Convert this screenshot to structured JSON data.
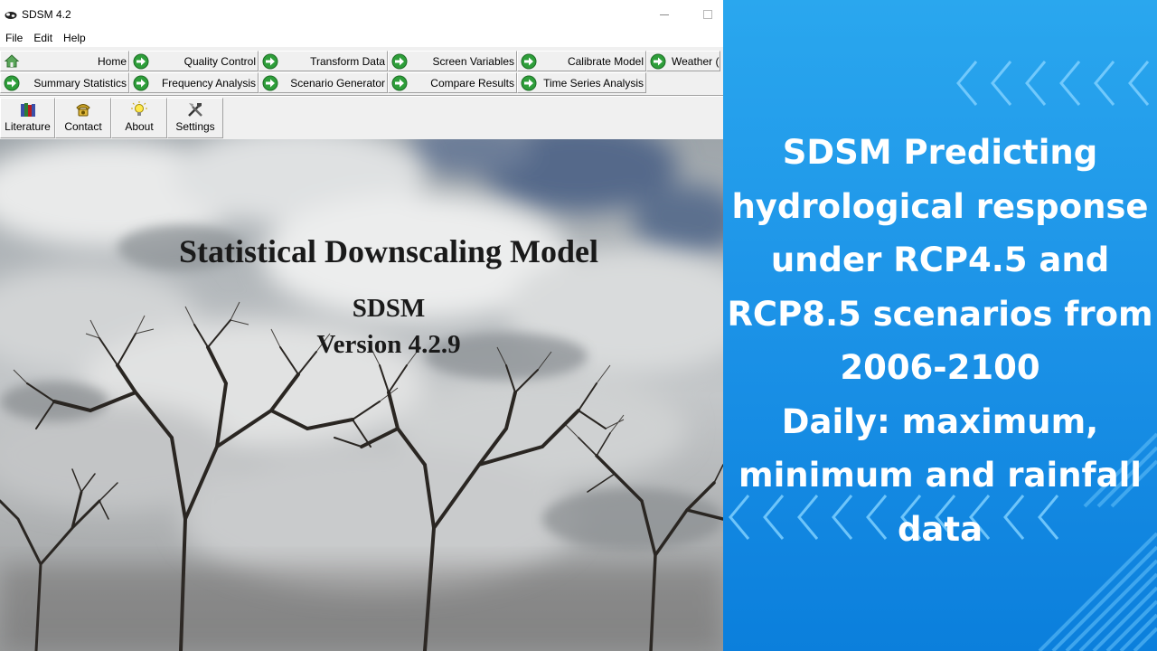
{
  "window": {
    "title": "SDSM 4.2"
  },
  "menu": [
    "File",
    "Edit",
    "Help"
  ],
  "nav_row_1": [
    {
      "label": "Home",
      "icon": "home-icon"
    },
    {
      "label": "Quality Control",
      "icon": "arrow-right-icon"
    },
    {
      "label": "Transform Data",
      "icon": "arrow-right-icon"
    },
    {
      "label": "Screen Variables",
      "icon": "arrow-right-icon"
    },
    {
      "label": "Calibrate Model",
      "icon": "arrow-right-icon"
    },
    {
      "label": "Weather (",
      "icon": "arrow-right-icon"
    }
  ],
  "nav_row_2": [
    {
      "label": "Summary Statistics",
      "icon": "arrow-right-icon"
    },
    {
      "label": "Frequency Analysis",
      "icon": "arrow-right-icon"
    },
    {
      "label": "Scenario Generator",
      "icon": "arrow-right-icon"
    },
    {
      "label": "Compare Results",
      "icon": "arrow-right-icon"
    },
    {
      "label": "Time Series Analysis",
      "icon": "arrow-right-icon"
    }
  ],
  "tools": [
    {
      "label": "Literature",
      "icon": "books-icon"
    },
    {
      "label": "Contact",
      "icon": "phone-icon"
    },
    {
      "label": "About",
      "icon": "lightbulb-icon"
    },
    {
      "label": "Settings",
      "icon": "tools-icon"
    }
  ],
  "splash": {
    "title": "Statistical Downscaling Model",
    "name": "SDSM",
    "version": "Version 4.2.9"
  },
  "promo": {
    "lines": [
      "SDSM Predicting",
      "hydrological response",
      "under RCP4.5 and",
      "RCP8.5 scenarios from",
      "2006-2100",
      "Daily: maximum,",
      "minimum and rainfall",
      "data"
    ]
  },
  "colors": {
    "nav_arrow": "#2e9e3a",
    "promo_blue": "#1d94e8"
  }
}
